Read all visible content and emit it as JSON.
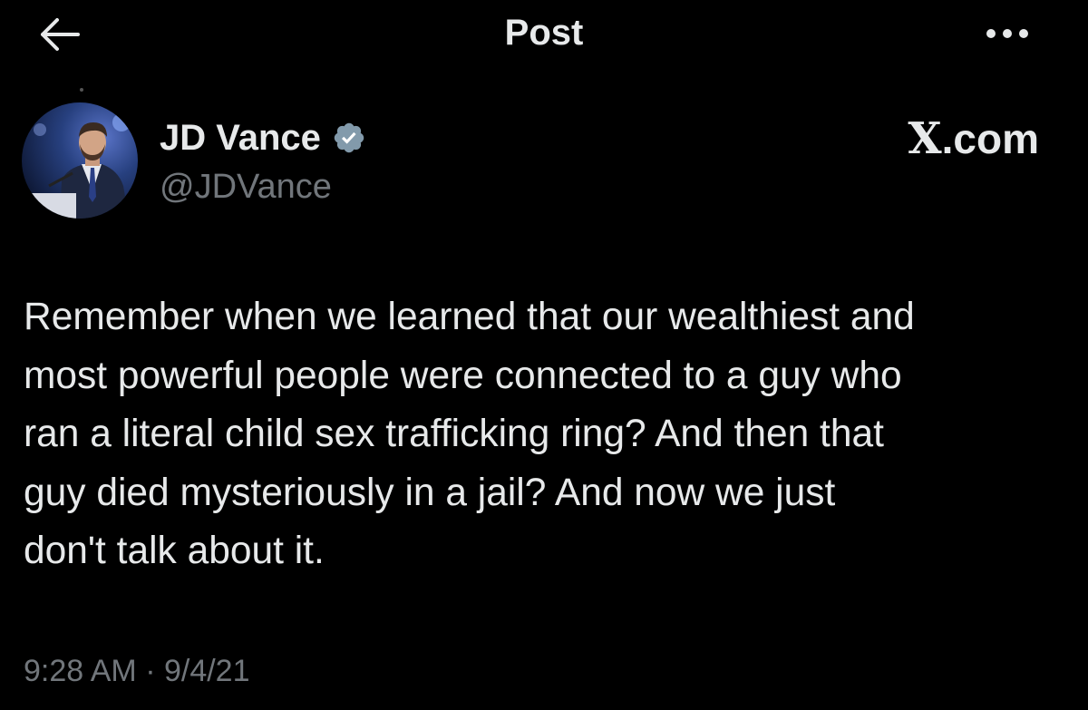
{
  "header": {
    "title": "Post",
    "back_icon": "arrow-left-icon",
    "more_icon": "more-horizontal-icon"
  },
  "author": {
    "display_name": "JD Vance",
    "handle": "@JDVance",
    "verified": true,
    "verified_icon": "verified-badge-icon",
    "verified_color": "#829aab"
  },
  "brand": {
    "mark": "X",
    "suffix": ".com"
  },
  "post": {
    "text": "Remember when we learned that our wealthiest and\nmost powerful people were connected to a guy who\nran a literal child sex trafficking ring? And then that\nguy died mysteriously in a jail? And now we just\ndon't talk about it.",
    "timestamp": "9:28 AM · 9/4/21"
  },
  "colors": {
    "background": "#000000",
    "primary_text": "#e7e9ea",
    "secondary_text": "#71767b"
  }
}
